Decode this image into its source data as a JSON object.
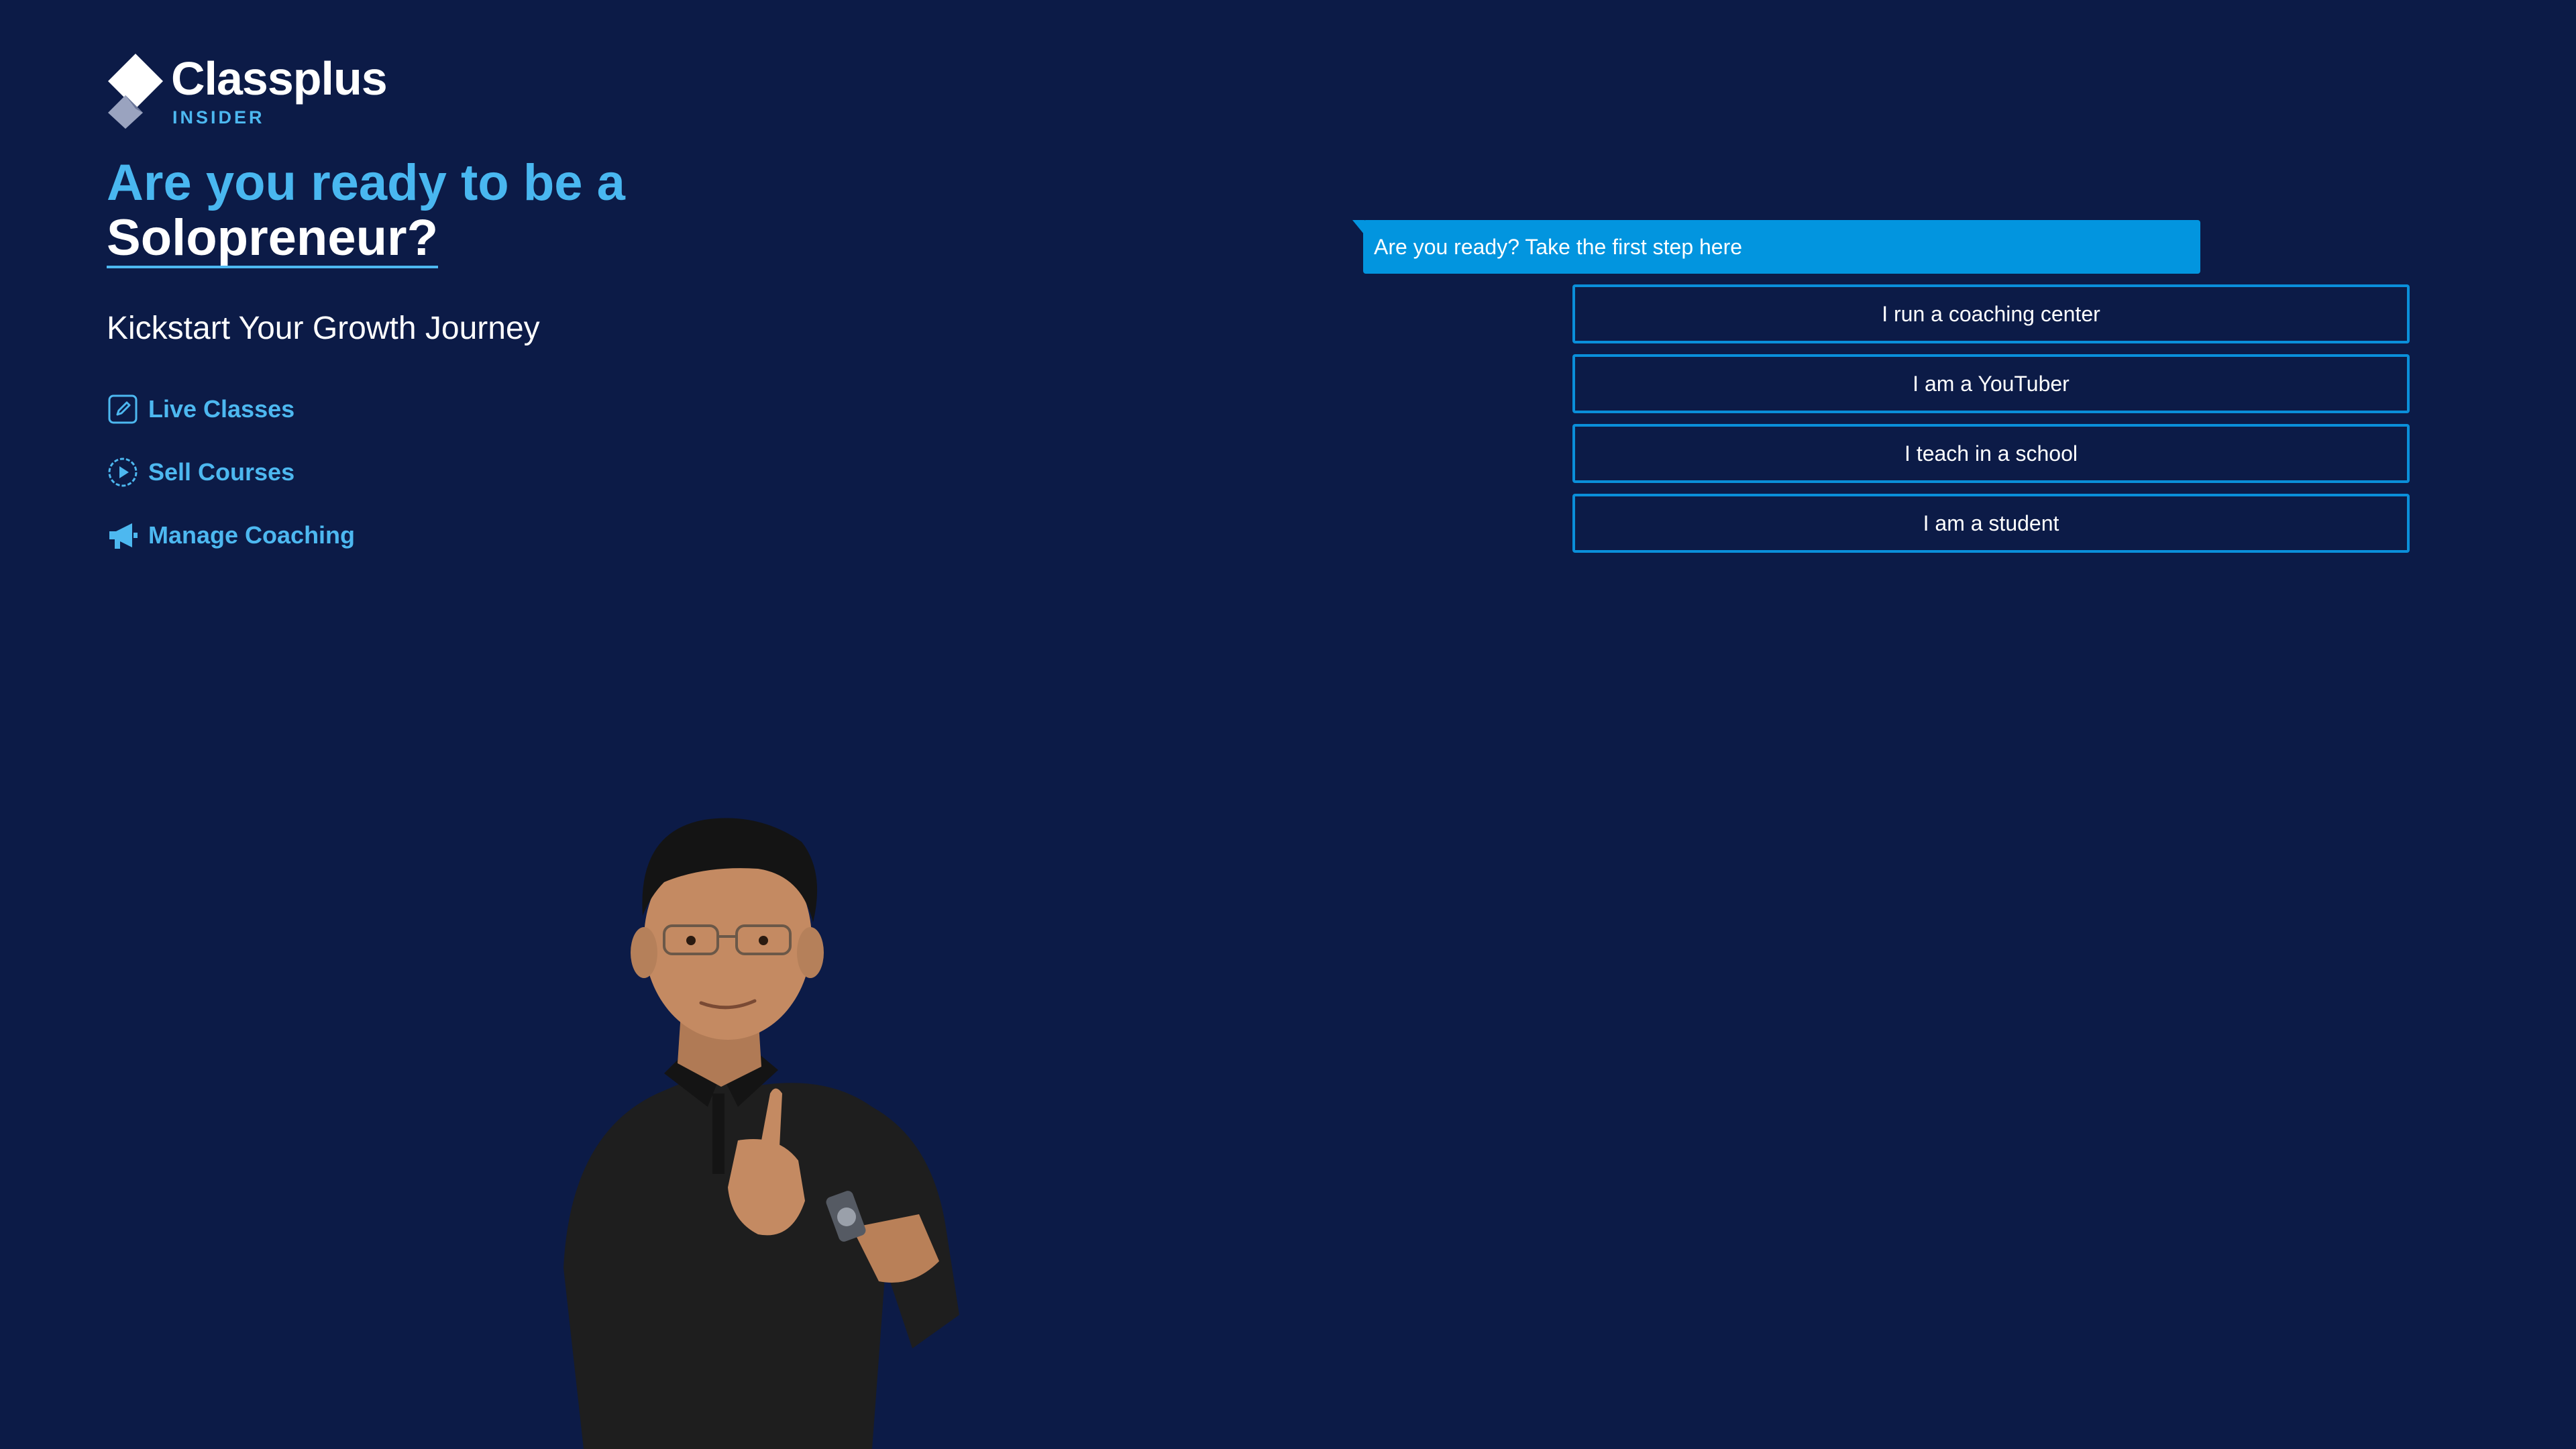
{
  "brand": {
    "name": "Classplus",
    "sub": "INSIDER"
  },
  "hero": {
    "headline_line1": "Are you ready to be a",
    "headline_line2": "Solopreneur?",
    "subheadline": "Kickstart Your Growth Journey"
  },
  "features": [
    {
      "label": "Live Classes",
      "icon": "edit-icon"
    },
    {
      "label": "Sell Courses",
      "icon": "play-circle-icon"
    },
    {
      "label": "Manage Coaching",
      "icon": "megaphone-icon"
    }
  ],
  "chat": {
    "prompt": "Are you ready? Take the first step here",
    "options": [
      "I run a coaching center",
      "I am a YouTuber",
      "I teach in a school",
      "I am a student"
    ]
  },
  "colors": {
    "background": "#0c1b47",
    "accent": "#4db8f0",
    "bubble": "#0295df",
    "option_border": "#0a8fda"
  }
}
